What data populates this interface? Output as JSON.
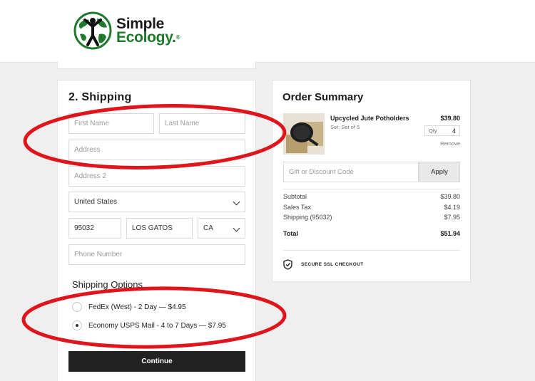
{
  "header": {
    "logo_line1": "Simple",
    "logo_line2": "Ecology",
    "logo_reg": "®"
  },
  "shipping": {
    "section_title": "2.  Shipping",
    "first_name_placeholder": "First Name",
    "last_name_placeholder": "Last Name",
    "address_placeholder": "Address",
    "address2_placeholder": "Address 2",
    "country": "United States",
    "zip": "95032",
    "city": "LOS GATOS",
    "state": "CA",
    "phone_placeholder": "Phone Number",
    "options_title": "Shipping Options",
    "options": [
      {
        "label": "FedEx (West) - 2 Day — $4.95",
        "selected": false
      },
      {
        "label": "Economy USPS Mail - 4 to 7 Days — $7.95",
        "selected": true
      }
    ],
    "continue_label": "Continue"
  },
  "summary": {
    "title": "Order Summary",
    "item": {
      "name": "Upcycled Jute Potholders",
      "variant": "Set: Set of 5",
      "price": "$39.80",
      "qty_label": "Qty",
      "qty": "4",
      "remove_label": "Remove"
    },
    "discount_placeholder": "Gift or Discount Code",
    "apply_label": "Apply",
    "lines": [
      {
        "label": "Subtotal",
        "value": "$39.80"
      },
      {
        "label": "Sales Tax",
        "value": "$4.19"
      },
      {
        "label": "Shipping (95032)",
        "value": "$7.95"
      }
    ],
    "total_label": "Total",
    "total_value": "$51.94",
    "ssl_label": "SECURE SSL CHECKOUT"
  },
  "colors": {
    "annotation_red": "#e0141b",
    "brand_green": "#1d7a2a",
    "button_dark": "#222222"
  },
  "icons": [
    "globe-person-logo-icon",
    "chevron-down-icon",
    "shield-check-icon"
  ]
}
